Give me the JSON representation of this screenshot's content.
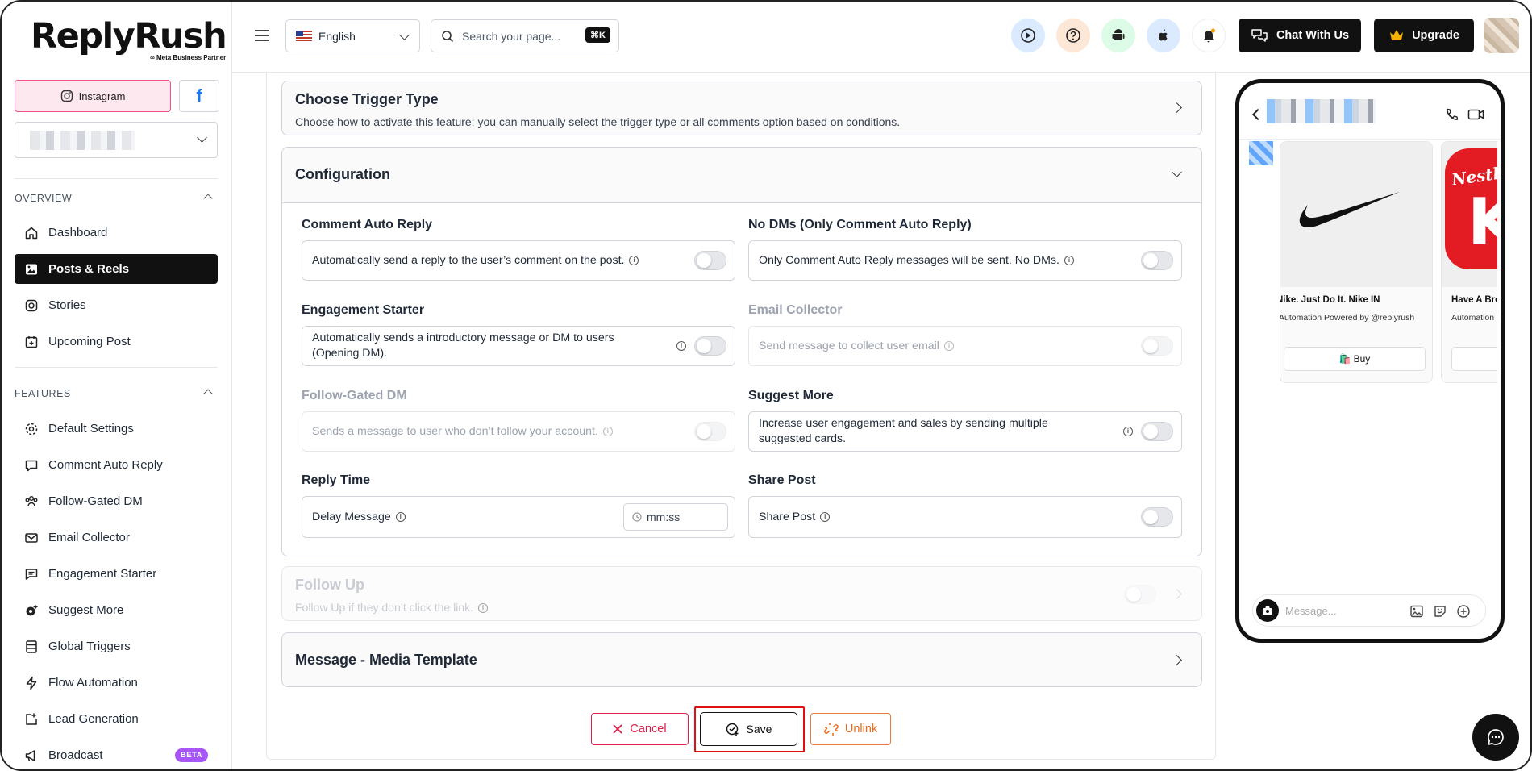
{
  "brand": {
    "name": "ReplyRush",
    "tagline": "Meta Business Partner"
  },
  "sidebar": {
    "platforms": {
      "instagram": "Instagram",
      "facebook": "f"
    },
    "overview_label": "OVERVIEW",
    "features_label": "FEATURES",
    "overview_items": [
      {
        "label": "Dashboard",
        "icon": "home-icon"
      },
      {
        "label": "Posts & Reels",
        "icon": "image-icon",
        "active": true
      },
      {
        "label": "Stories",
        "icon": "instagram-icon"
      },
      {
        "label": "Upcoming Post",
        "icon": "calendar-plus-icon"
      }
    ],
    "feature_items": [
      {
        "label": "Default Settings",
        "icon": "gear-icon"
      },
      {
        "label": "Comment Auto Reply",
        "icon": "comment-icon"
      },
      {
        "label": "Follow-Gated DM",
        "icon": "users-icon"
      },
      {
        "label": "Email Collector",
        "icon": "mail-icon"
      },
      {
        "label": "Engagement Starter",
        "icon": "message-square-icon"
      },
      {
        "label": "Suggest More",
        "icon": "cog-sparkle-icon"
      },
      {
        "label": "Global Triggers",
        "icon": "list-icon"
      },
      {
        "label": "Flow Automation",
        "icon": "bolt-icon"
      },
      {
        "label": "Lead Generation",
        "icon": "lead-icon"
      },
      {
        "label": "Broadcast",
        "icon": "megaphone-icon",
        "badge": "BETA"
      }
    ]
  },
  "topbar": {
    "language": "English",
    "search_placeholder": "Search your page...",
    "search_shortcut": "⌘K",
    "chat_label": "Chat With Us",
    "upgrade_label": "Upgrade"
  },
  "main": {
    "trigger": {
      "title": "Choose Trigger Type",
      "desc": "Choose how to activate this feature: you can manually select the trigger type or all comments option based on conditions."
    },
    "configuration": {
      "title": "Configuration"
    },
    "options": {
      "comment_auto_reply": {
        "label": "Comment Auto Reply",
        "text": "Automatically send a reply to the user’s comment on the post."
      },
      "no_dms": {
        "label": "No DMs (Only Comment Auto Reply)",
        "text": "Only Comment Auto Reply messages will be sent. No DMs."
      },
      "engagement_starter": {
        "label": "Engagement Starter",
        "text": "Automatically sends a introductory message or DM to users (Opening DM)."
      },
      "email_collector": {
        "label": "Email Collector",
        "text": "Send message to collect user email"
      },
      "follow_gated": {
        "label": "Follow-Gated DM",
        "text": "Sends a message to user who don’t follow your account."
      },
      "suggest_more": {
        "label": "Suggest More",
        "text": "Increase user engagement and sales by sending multiple suggested cards."
      },
      "reply_time": {
        "label": "Reply Time",
        "text": "Delay Message",
        "placeholder": "mm:ss"
      },
      "share_post": {
        "label": "Share Post",
        "text": "Share Post"
      }
    },
    "follow_up": {
      "title": "Follow Up",
      "desc": "Follow Up if they don’t click the link."
    },
    "media_template": {
      "title": "Message - Media Template"
    },
    "buttons": {
      "cancel": "Cancel",
      "save": "Save",
      "unlink": "Unlink"
    }
  },
  "preview": {
    "cards": [
      {
        "title": "Nike. Just Do It. Nike IN",
        "sub": "Automation Powered by @replyrush",
        "button": "Buy"
      },
      {
        "title": "Have A Break",
        "sub": "Automation Powered by @replyrush",
        "button": ""
      }
    ],
    "message_placeholder": "Message..."
  },
  "colors": {
    "accent_dark": "#111111",
    "instagram_pink": "#ef4f8a",
    "cancel_red": "#e11d48",
    "unlink_orange": "#ea6a1a",
    "highlight_red": "#e01010"
  }
}
